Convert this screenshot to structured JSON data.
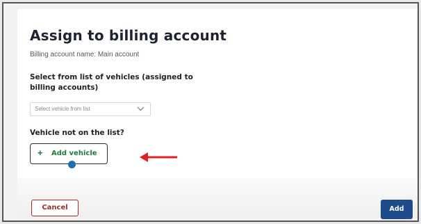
{
  "dialog": {
    "title": "Assign to billing account",
    "subtitle": "Billing account name: Main account"
  },
  "vehicle_select": {
    "label": "Select from list of vehicles (assigned to billing accounts)",
    "placeholder": "Select vehicle from list",
    "icon": "chevron-down-icon"
  },
  "not_on_list": {
    "label": "Vehicle not on the list?",
    "button_icon": "+",
    "button_label": "Add vehicle"
  },
  "footer": {
    "cancel_label": "Cancel",
    "add_label": "Add"
  },
  "colors": {
    "accent_green": "#1e7a3c",
    "primary_blue": "#1e4c8a",
    "cancel_red": "#9a2d2d",
    "annotation_arrow": "#e02020"
  }
}
